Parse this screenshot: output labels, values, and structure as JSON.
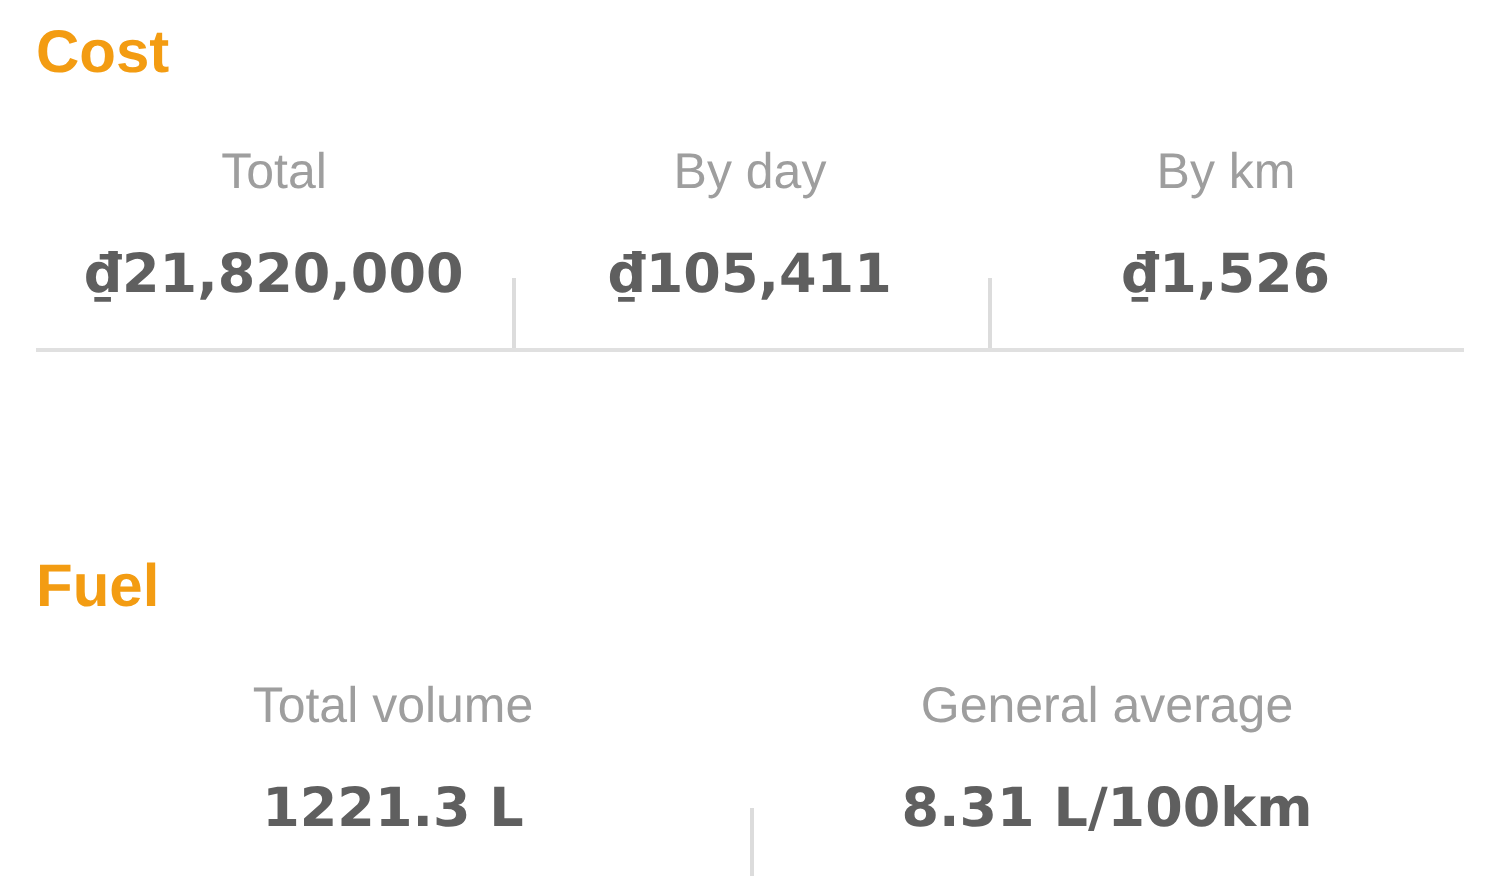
{
  "sections": [
    {
      "title": "Cost",
      "underlined": true,
      "stats": [
        {
          "label": "Total",
          "value": "₫21,820,000"
        },
        {
          "label": "By day",
          "value": "₫105,411"
        },
        {
          "label": "By km",
          "value": "₫1,526"
        }
      ]
    },
    {
      "title": "Fuel",
      "underlined": false,
      "stats": [
        {
          "label": "Total volume",
          "value": "1221.3 L"
        },
        {
          "label": "General average",
          "value": "8.31 L/100km"
        }
      ]
    }
  ]
}
